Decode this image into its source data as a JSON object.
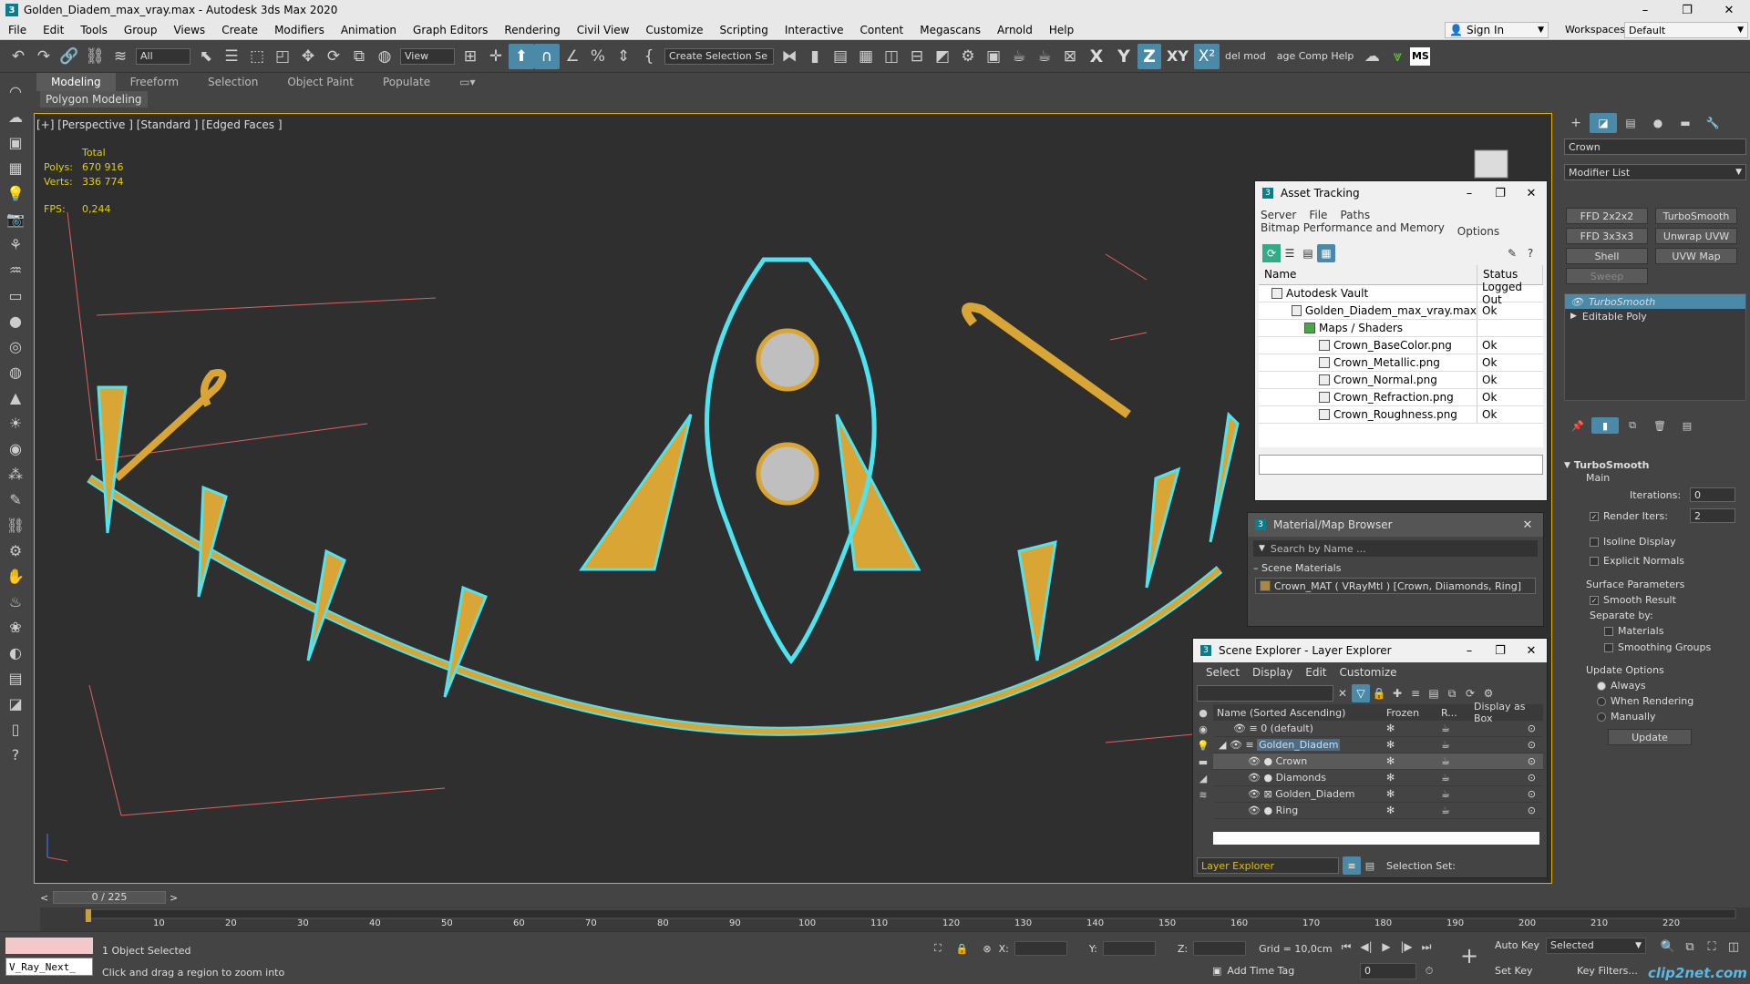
{
  "window": {
    "title": "Golden_Diadem_max_vray.max - Autodesk 3ds Max 2020",
    "app_icon": "3",
    "controls": [
      "–",
      "❐",
      "✕"
    ]
  },
  "menu": {
    "items": [
      "File",
      "Edit",
      "Tools",
      "Group",
      "Views",
      "Create",
      "Modifiers",
      "Animation",
      "Graph Editors",
      "Rendering",
      "Civil View",
      "Customize",
      "Scripting",
      "Interactive",
      "Content",
      "Megascans",
      "Arnold",
      "Help"
    ],
    "sign_in": "Sign In",
    "workspaces_label": "Workspaces:",
    "workspace_value": "Default"
  },
  "toolbar": {
    "filter": "All",
    "ref_coord": "View",
    "selection_set": "Create Selection Se",
    "axes": [
      "X",
      "Y",
      "Z",
      "XY"
    ],
    "extra1": "del mod",
    "extra2": "age Comp Help",
    "ms_label": "MS"
  },
  "ribbon": {
    "tabs": [
      "Modeling",
      "Freeform",
      "Selection",
      "Object Paint",
      "Populate"
    ],
    "subtitle": "Polygon Modeling"
  },
  "viewport": {
    "label": "[+] [Perspective ] [Standard ] [Edged Faces ]",
    "stats_total": "Total",
    "polys_label": "Polys:",
    "polys_value": "670 916",
    "verts_label": "Verts:",
    "verts_value": "336 774",
    "fps_label": "FPS:",
    "fps_value": "0,244"
  },
  "asset_tracking": {
    "title": "Asset Tracking",
    "menu": [
      "Server",
      "File",
      "Paths",
      "Bitmap Performance and Memory",
      "Options"
    ],
    "columns": [
      "Name",
      "Status"
    ],
    "rows": [
      {
        "name": "Autodesk Vault",
        "status": "Logged Out",
        "indent": 0
      },
      {
        "name": "Golden_Diadem_max_vray.max",
        "status": "Ok",
        "indent": 1
      },
      {
        "name": "Maps / Shaders",
        "status": "",
        "indent": 2
      },
      {
        "name": "Crown_BaseColor.png",
        "status": "Ok",
        "indent": 3
      },
      {
        "name": "Crown_Metallic.png",
        "status": "Ok",
        "indent": 3
      },
      {
        "name": "Crown_Normal.png",
        "status": "Ok",
        "indent": 3
      },
      {
        "name": "Crown_Refraction.png",
        "status": "Ok",
        "indent": 3
      },
      {
        "name": "Crown_Roughness.png",
        "status": "Ok",
        "indent": 3
      }
    ]
  },
  "material_browser": {
    "title": "Material/Map Browser",
    "search_placeholder": "Search by Name ...",
    "section": "Scene Materials",
    "item": "Crown_MAT ( VRayMtl ) [Crown, Diiamonds, Ring]"
  },
  "scene_explorer": {
    "title": "Scene Explorer - Layer Explorer",
    "menu": [
      "Select",
      "Display",
      "Edit",
      "Customize"
    ],
    "columns": [
      "Name (Sorted Ascending)",
      "Frozen",
      "R...",
      "Display as Box"
    ],
    "rows": [
      {
        "name": "0 (default)",
        "indent": 1,
        "selected": false
      },
      {
        "name": "Golden_Diadem",
        "indent": 1,
        "selected": false
      },
      {
        "name": "Crown",
        "indent": 2,
        "selected": true
      },
      {
        "name": "Diamonds",
        "indent": 2,
        "selected": false
      },
      {
        "name": "Golden_Diadem",
        "indent": 2,
        "selected": false
      },
      {
        "name": "Ring",
        "indent": 2,
        "selected": false
      }
    ],
    "footer_dropdown": "Layer Explorer",
    "selection_set_label": "Selection Set:"
  },
  "command_panel": {
    "object_name": "Crown",
    "modifier_list": "Modifier List",
    "buttons": [
      "FFD 2x2x2",
      "TurboSmooth",
      "FFD 3x3x3",
      "Unwrap UVW",
      "Shell",
      "UVW Map",
      "Sweep"
    ],
    "stack": [
      "TurboSmooth",
      "Editable Poly"
    ],
    "rollout_title": "TurboSmooth",
    "main_label": "Main",
    "iterations_label": "Iterations:",
    "iterations_value": "0",
    "render_iters_label": "Render Iters:",
    "render_iters_value": "2",
    "isoline": "Isoline Display",
    "explicit_normals": "Explicit Normals",
    "surface_params": "Surface Parameters",
    "smooth_result": "Smooth Result",
    "separate_by": "Separate by:",
    "materials": "Materials",
    "smoothing_groups": "Smoothing Groups",
    "update_options": "Update Options",
    "always": "Always",
    "when_rendering": "When Rendering",
    "manually": "Manually",
    "update_btn": "Update"
  },
  "timeline": {
    "frame": "0 / 225",
    "ticks": [
      "10",
      "20",
      "30",
      "40",
      "50",
      "60",
      "70",
      "80",
      "90",
      "100",
      "110",
      "120",
      "130",
      "140",
      "150",
      "160",
      "170",
      "180",
      "190",
      "200",
      "210",
      "220"
    ]
  },
  "status": {
    "maxscript": "V_Ray_Next_",
    "selected": "1 Object Selected",
    "prompt": "Click and drag a region to zoom into",
    "x_label": "X:",
    "y_label": "Y:",
    "z_label": "Z:",
    "grid": "Grid = 10,0cm",
    "add_time_tag": "Add Time Tag",
    "auto_key": "Auto Key",
    "selected_dd": "Selected",
    "set_key": "Set Key",
    "key_filters": "Key Filters...",
    "frame_field": "0",
    "watermark": "clip2net.com"
  },
  "colors": {
    "accent": "#4a8aa8",
    "viewport_border": "#e0b000",
    "stats": "#e0d000",
    "gold": "#d9a635",
    "selection": "#4fe3f0"
  }
}
